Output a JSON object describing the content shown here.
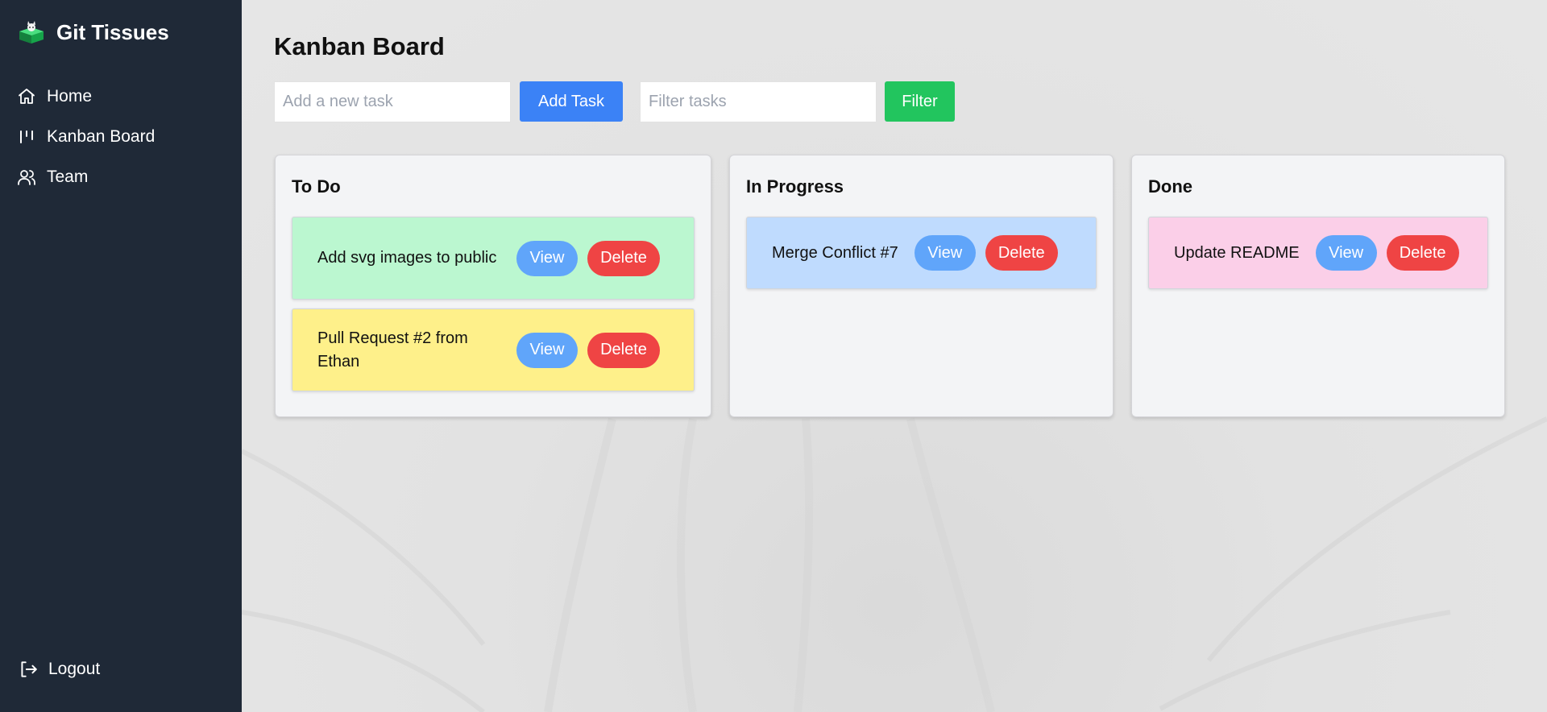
{
  "app": {
    "name": "Git Tissues",
    "logo_icon": "cat-box-logo"
  },
  "sidebar": {
    "items": [
      {
        "label": "Home",
        "icon": "home-icon"
      },
      {
        "label": "Kanban Board",
        "icon": "kanban-icon"
      },
      {
        "label": "Team",
        "icon": "users-icon"
      }
    ],
    "logout": {
      "label": "Logout",
      "icon": "logout-icon"
    }
  },
  "main": {
    "title": "Kanban Board",
    "toolbar": {
      "new_task_placeholder": "Add a new task",
      "new_task_value": "",
      "add_label": "Add Task",
      "filter_placeholder": "Filter tasks",
      "filter_value": "",
      "filter_label": "Filter"
    },
    "columns": [
      {
        "title": "To Do",
        "cards": [
          {
            "text": "Add svg images to public",
            "color": "#bbf7d0",
            "view": "View",
            "delete": "Delete"
          },
          {
            "text": "Pull Request #2 from Ethan",
            "color": "#fef08a",
            "view": "View",
            "delete": "Delete"
          }
        ]
      },
      {
        "title": "In Progress",
        "cards": [
          {
            "text": "Merge Conflict #7",
            "color": "#bfdbfe",
            "view": "View",
            "delete": "Delete"
          }
        ]
      },
      {
        "title": "Done",
        "cards": [
          {
            "text": "Update README",
            "color": "#fbcfe8",
            "view": "View",
            "delete": "Delete"
          }
        ]
      }
    ]
  },
  "colors": {
    "sidebar_bg": "#1f2937",
    "add_button": "#3b82f6",
    "filter_button": "#22c55e",
    "view_button": "#60a5fa",
    "delete_button": "#ef4444"
  }
}
